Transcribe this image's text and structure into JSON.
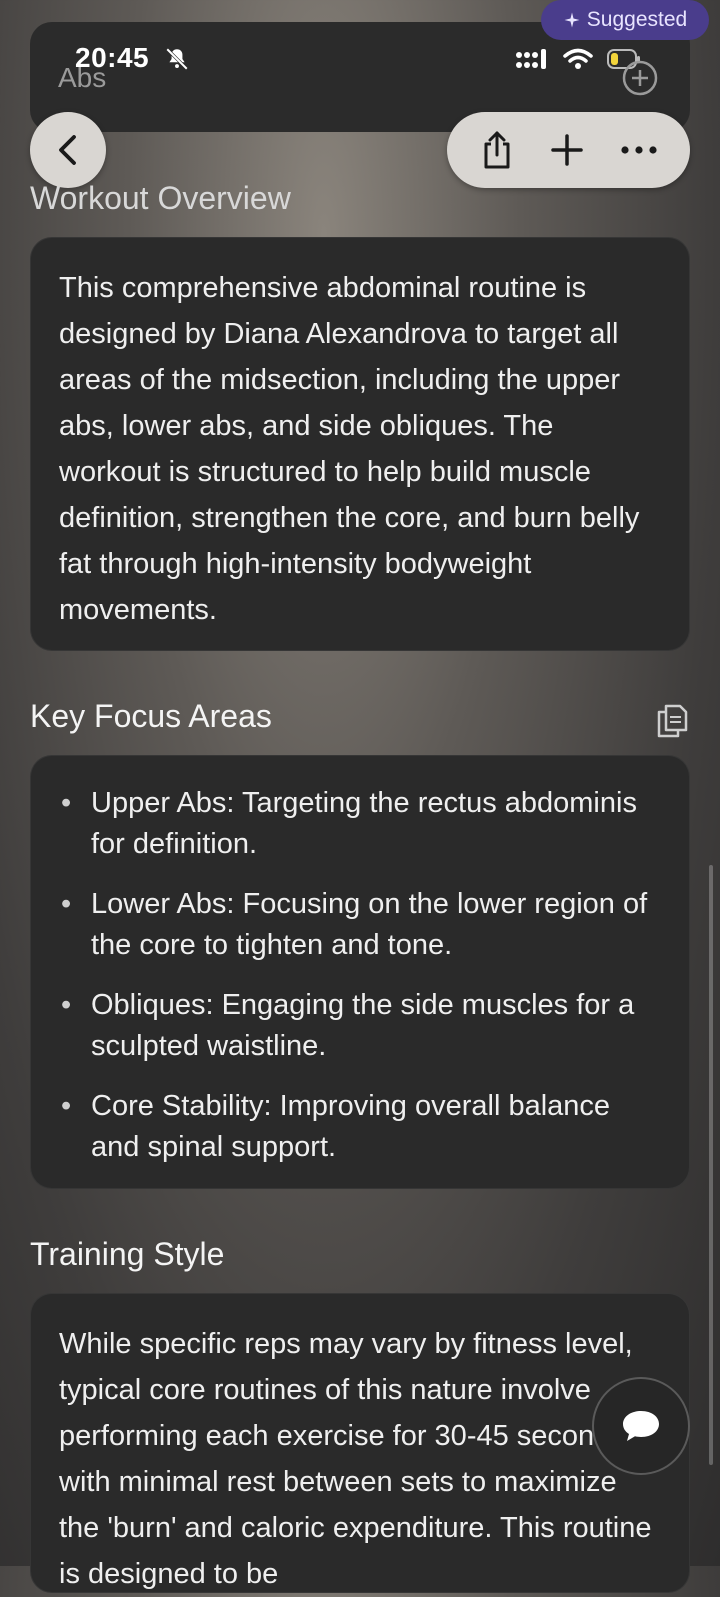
{
  "status_bar": {
    "time": "20:45"
  },
  "header": {
    "title": "Abs",
    "suggested_label": "Suggested"
  },
  "overview": {
    "title": "Workout Overview",
    "body": "This comprehensive abdominal routine is designed by Diana Alexandrova to target all areas of the midsection, including the upper abs, lower abs, and side obliques. The workout is structured to help build muscle definition, strengthen the core, and burn belly fat through high-intensity bodyweight movements."
  },
  "focus": {
    "title": "Key Focus Areas",
    "items": [
      "Upper Abs: Targeting the rectus abdominis for definition.",
      "Lower Abs: Focusing on the lower region of the core to tighten and tone.",
      "Obliques: Engaging the side muscles for a sculpted waistline.",
      "Core Stability: Improving overall balance and spinal support."
    ]
  },
  "training": {
    "title": "Training Style",
    "body": "While specific reps may vary by fitness level, typical core routines of this nature involve performing each exercise for 30-45 seconds with minimal rest between sets to maximize the 'burn' and caloric expenditure. This routine is designed to be"
  },
  "icons": {
    "back": "chevron-left-icon",
    "share": "share-icon",
    "add": "plus-icon",
    "more": "ellipsis-icon",
    "copy": "copy-icon",
    "chat": "chat-bubble-icon"
  },
  "colors": {
    "suggested_bg": "#4a3d8c",
    "card_bg": "#2a2a2a",
    "pill_bg": "#d9d6d2"
  }
}
